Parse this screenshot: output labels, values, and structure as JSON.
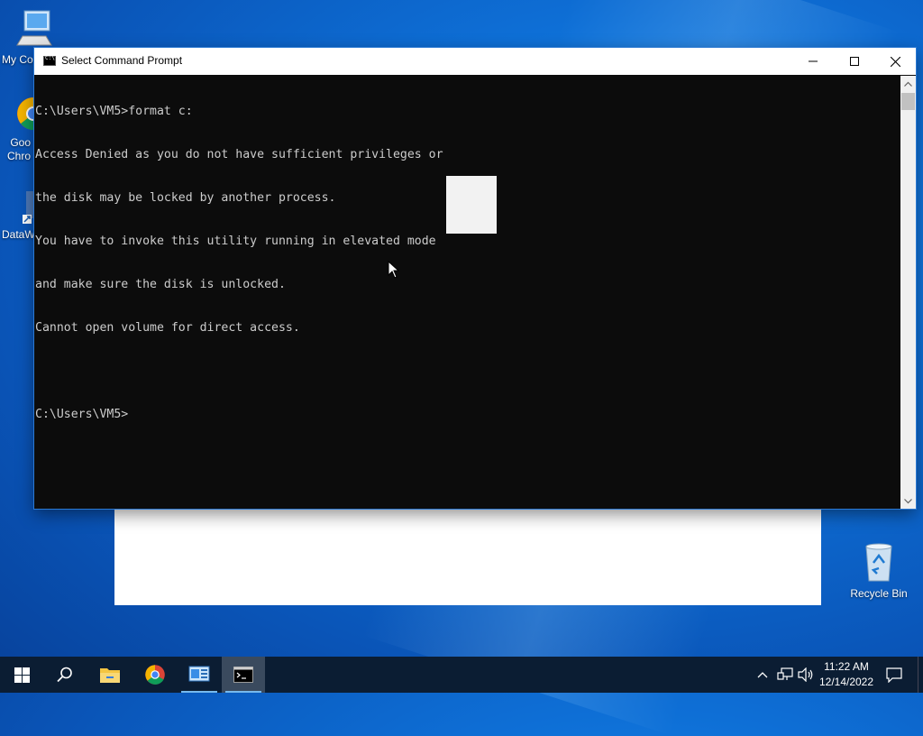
{
  "desktop": {
    "icons": [
      {
        "label": "My Co"
      },
      {
        "label": "Goo\nChro"
      },
      {
        "label": "DataW"
      },
      {
        "label": "Recycle Bin"
      }
    ]
  },
  "cmd_window": {
    "title": "Select Command Prompt",
    "lines": [
      "C:\\Users\\VM5>format c:",
      "Access Denied as you do not have sufficient privileges or",
      "the disk may be locked by another process.",
      "You have to invoke this utility running in elevated mode",
      "and make sure the disk is unlocked.",
      "Cannot open volume for direct access.",
      "",
      "C:\\Users\\VM5>"
    ]
  },
  "taskbar": {
    "items": [
      {
        "icon": "windows-start-icon"
      },
      {
        "icon": "search-icon"
      },
      {
        "icon": "file-explorer-icon"
      },
      {
        "icon": "chrome-icon"
      },
      {
        "icon": "control-panel-icon"
      },
      {
        "icon": "command-prompt-icon",
        "active": true
      }
    ],
    "clock": {
      "time": "11:22 AM",
      "date": "12/14/2022"
    }
  },
  "colors": {
    "accent": "#76b9ed",
    "console_bg": "#0c0c0c",
    "console_fg": "#cccccc"
  }
}
